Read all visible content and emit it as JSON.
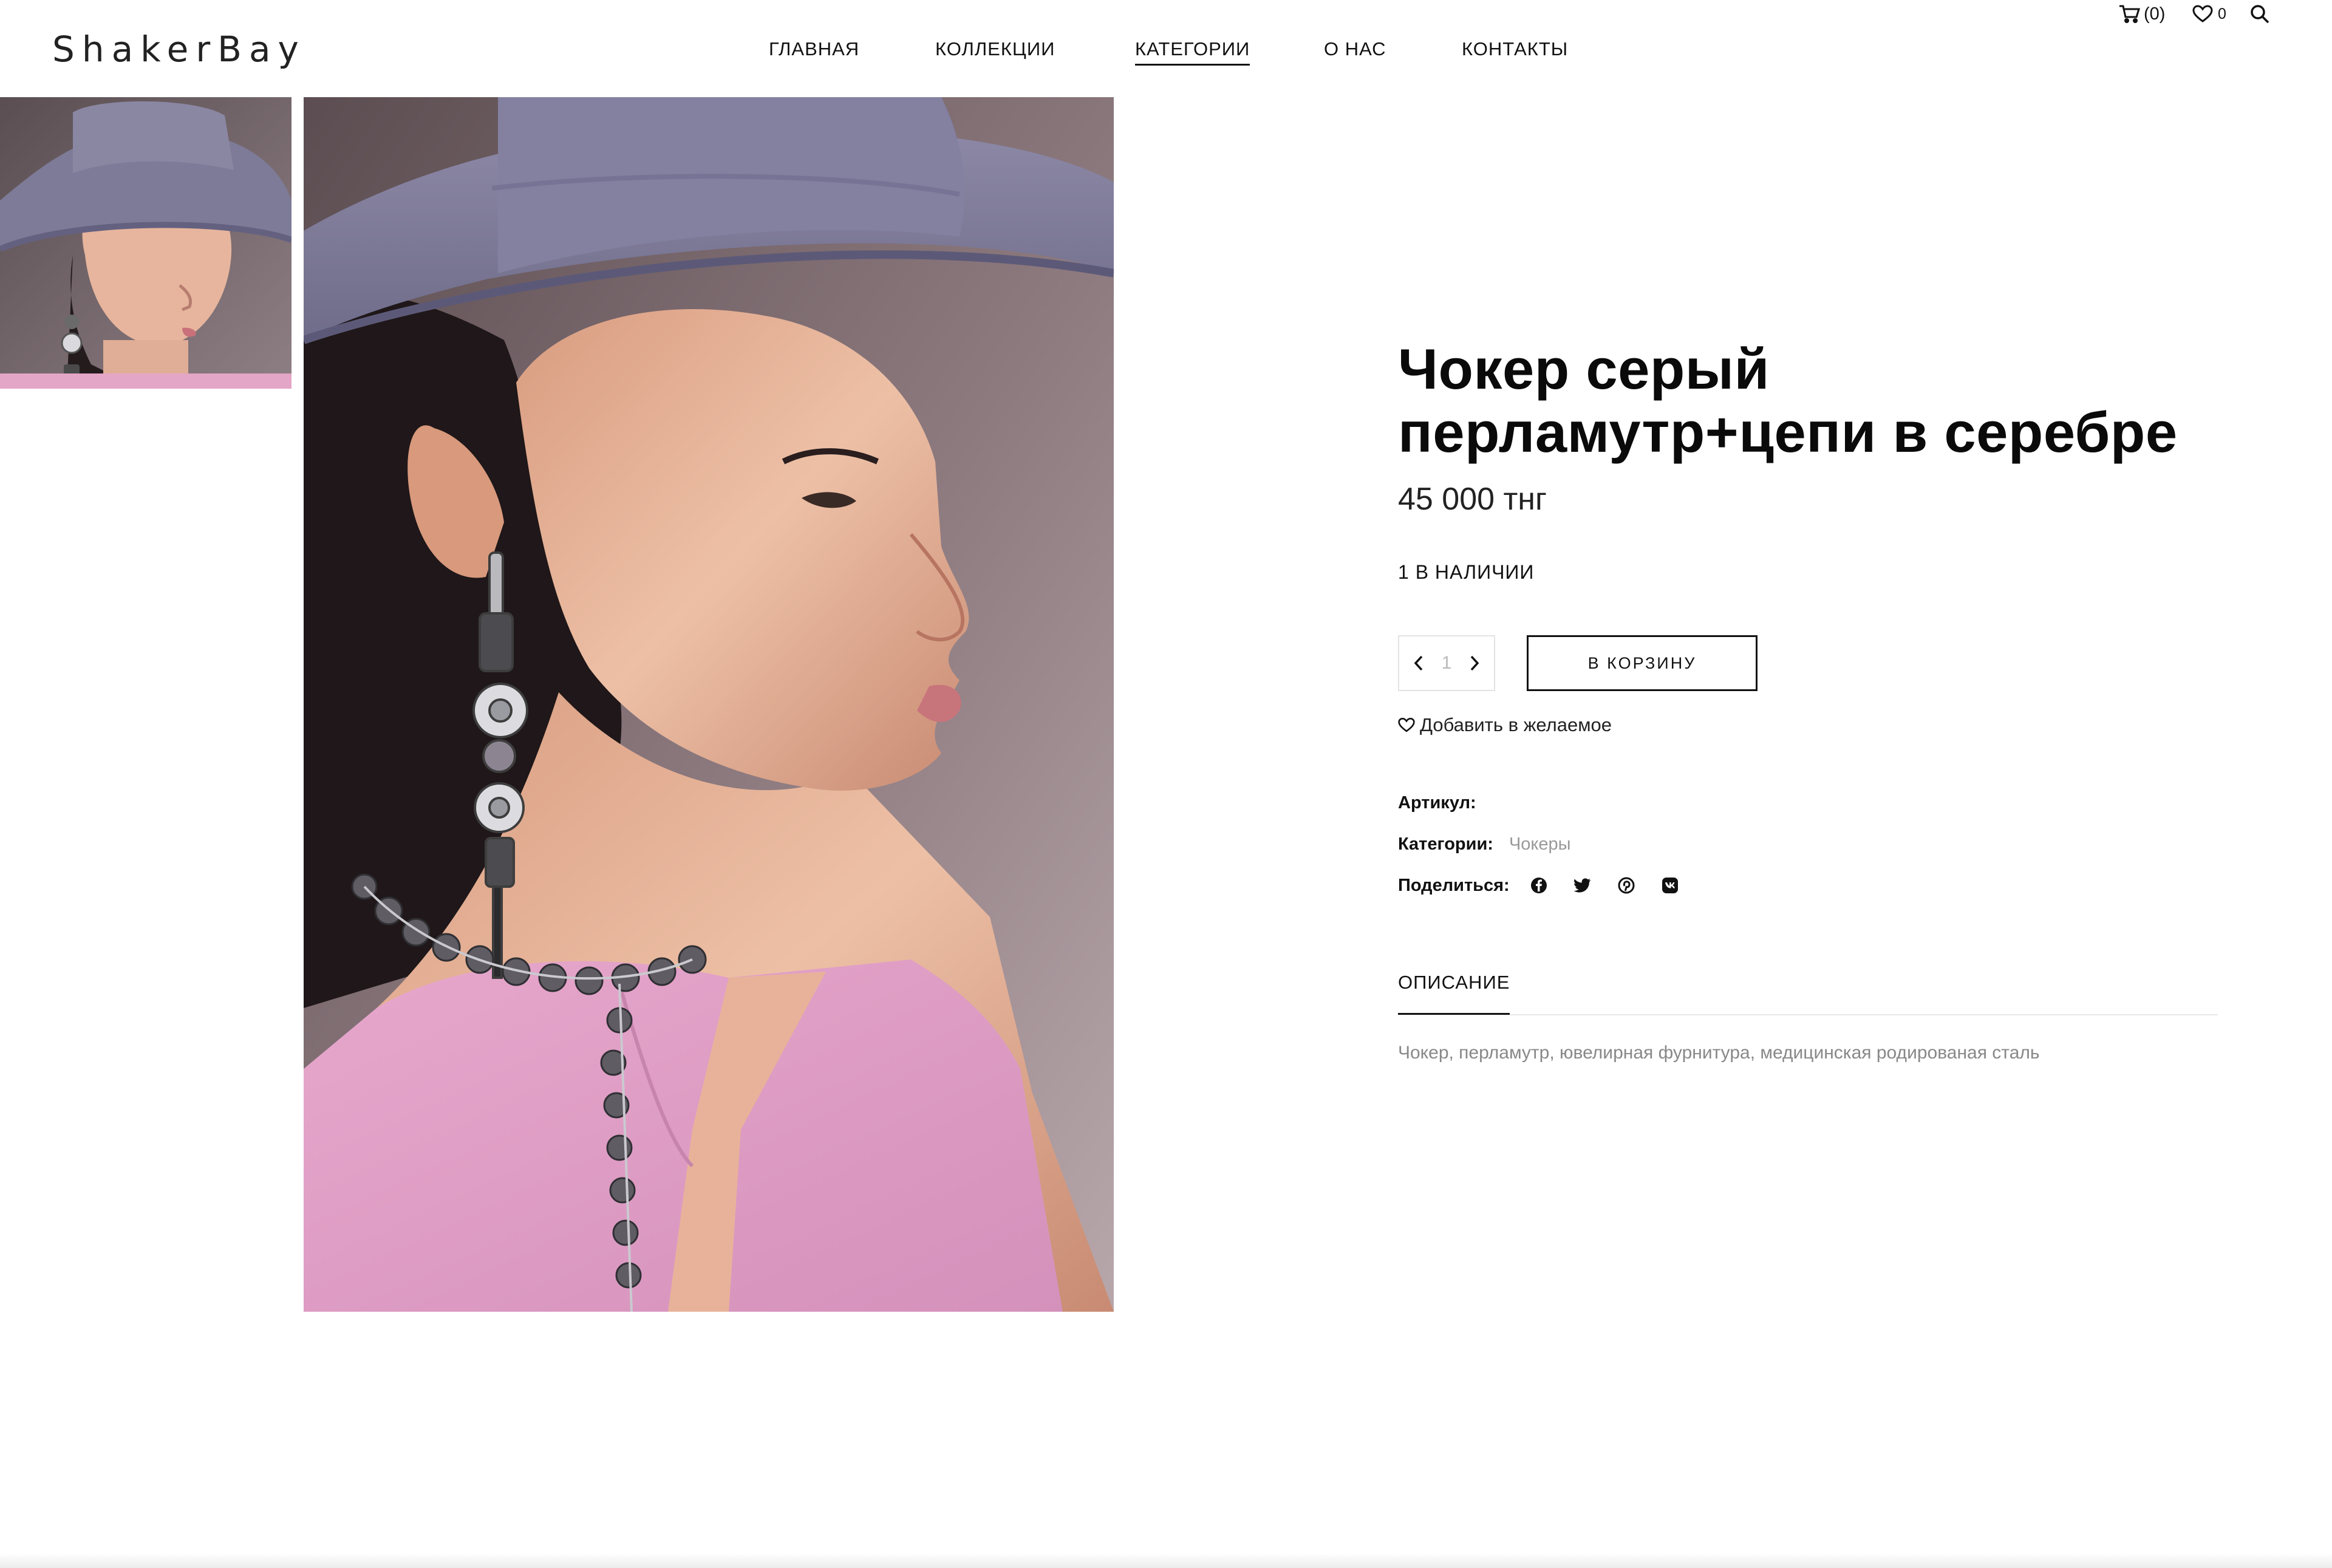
{
  "brand": {
    "logo": "ShakerBay"
  },
  "nav": {
    "items": [
      {
        "label": "ГЛАВНАЯ"
      },
      {
        "label": "КОЛЛЕКЦИИ"
      },
      {
        "label": "КАТЕГОРИИ",
        "active": true
      },
      {
        "label": "О НАС"
      },
      {
        "label": "КОНТАКТЫ"
      }
    ]
  },
  "header_tools": {
    "cart_count": "(0)",
    "wishlist_count": "0",
    "icons": [
      "cart-icon",
      "heart-icon",
      "search-icon"
    ]
  },
  "product": {
    "title": "Чокер серый перламутр+цепи в серебре",
    "price": "45 000 тнг",
    "stock": "1 В НАЛИЧИИ",
    "quantity": "1",
    "add_to_cart_label": "В КОРЗИНУ",
    "wishlist_label": "Добавить в желаемое",
    "sku_label": "Артикул:",
    "categories_label": "Категории:",
    "category": "Чокеры",
    "share_label": "Поделиться:",
    "share_icons": [
      "facebook-icon",
      "twitter-icon",
      "pinterest-icon",
      "vk-icon"
    ]
  },
  "tabs": [
    {
      "label": "ОПИСАНИЕ",
      "active": true
    }
  ],
  "description": "Чокер, перламутр, ювелирная фурнитура, медицинская родированая сталь",
  "colors": {
    "text": "#111111",
    "muted": "#999999",
    "hat": "#7d7a96",
    "blouse": "#d99bc1"
  }
}
